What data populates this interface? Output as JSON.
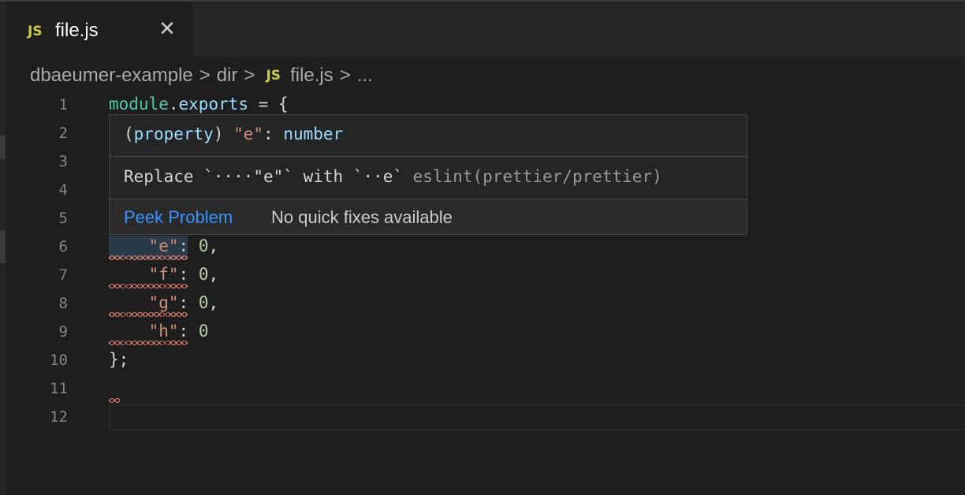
{
  "tab": {
    "badge": "JS",
    "label": "file.js",
    "close": "✕"
  },
  "breadcrumb": {
    "folder": "dbaeumer-example",
    "sep": ">",
    "dir": "dir",
    "badge": "JS",
    "file": "file.js",
    "more": "..."
  },
  "line_numbers": [
    "1",
    "2",
    "3",
    "4",
    "5",
    "6",
    "7",
    "8",
    "9",
    "10",
    "11",
    "12"
  ],
  "code": {
    "line1": {
      "a": "module",
      "b": ".",
      "c": "exports",
      "d": " = {"
    },
    "line6": {
      "indent": "    ",
      "key": "\"e\"",
      "colon": ": ",
      "val": "0",
      "end": ","
    },
    "line7": {
      "indent": "    ",
      "key": "\"f\"",
      "colon": ": ",
      "val": "0",
      "end": ","
    },
    "line8": {
      "indent": "    ",
      "key": "\"g\"",
      "colon": ": ",
      "val": "0",
      "end": ","
    },
    "line9": {
      "indent": "    ",
      "key": "\"h\"",
      "colon": ": ",
      "val": "0"
    },
    "line10": "};"
  },
  "hover": {
    "signature": {
      "open": "(",
      "kind": "property",
      "close": ") ",
      "name": "\"e\"",
      "colon": ": ",
      "type": "number"
    },
    "message": {
      "text": "Replace `····\"e\"` with `··e` ",
      "source": "eslint(prettier/prettier)"
    },
    "peek_label": "Peek Problem",
    "no_fix_label": "No quick fixes available"
  },
  "colors": {
    "accent": "#3794ff",
    "error": "#f48771",
    "js_badge": "#cbcb41",
    "background": "#1e1e1e"
  }
}
